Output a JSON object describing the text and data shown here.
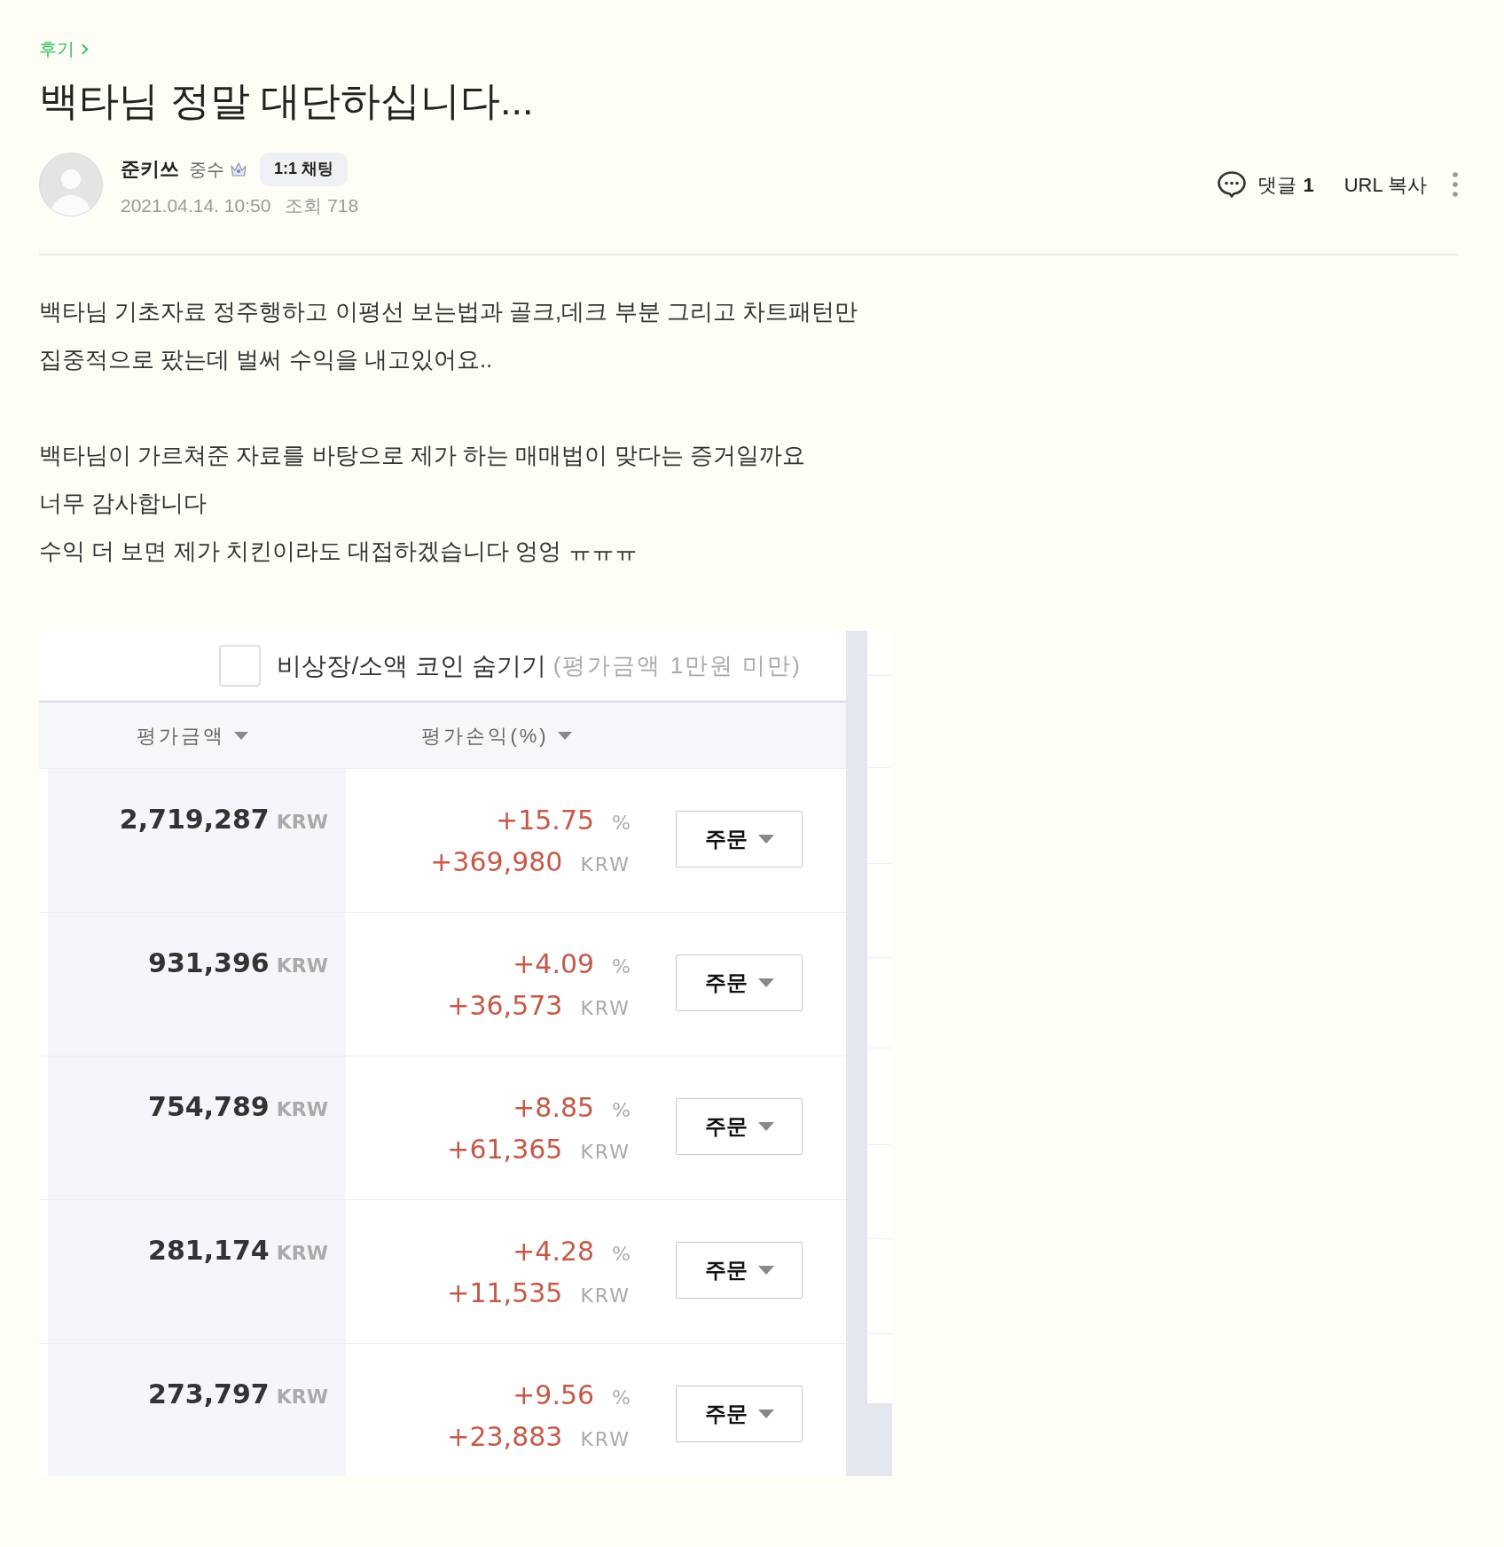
{
  "board": {
    "label": "후기"
  },
  "post": {
    "title": "백타님 정말 대단하십니다..."
  },
  "author": {
    "name": "준키쓰",
    "rank": "중수",
    "chat_button": "1:1 채팅",
    "date": "2021.04.14. 10:50",
    "views": "조회 718"
  },
  "actions": {
    "comments_label": "댓글",
    "comments_count": "1",
    "copy_url": "URL 복사"
  },
  "body": {
    "paragraphs": [
      [
        "백타님 기초자료 정주행하고 이평선 보는법과 골크,데크 부분 그리고 차트패턴만",
        "집중적으로 팠는데 벌써 수익을 내고있어요.."
      ],
      [
        "백타님이 가르쳐준 자료를 바탕으로 제가 하는 매매법이 맞다는 증거일까요",
        "너무 감사합니다",
        "수익 더 보면 제가 치킨이라도 대접하겠습니다 엉엉 ㅠㅠㅠ"
      ]
    ]
  },
  "screenshot": {
    "filter": {
      "checked": false,
      "label": "비상장/소액 코인 숨기기",
      "note": "(평가금액 1만원 미만)"
    },
    "columns": [
      {
        "label": "평가금액"
      },
      {
        "label": "평가손익(%)"
      }
    ],
    "rows": [
      {
        "amount": "2,719,287",
        "amount_unit": "KRW",
        "rate": "+15.75",
        "rate_unit": "%",
        "profit": "+369,980",
        "profit_unit": "KRW",
        "order_button": "주문"
      },
      {
        "amount": "931,396",
        "amount_unit": "KRW",
        "rate": "+4.09",
        "rate_unit": "%",
        "profit": "+36,573",
        "profit_unit": "KRW",
        "order_button": "주문"
      },
      {
        "amount": "754,789",
        "amount_unit": "KRW",
        "rate": "+8.85",
        "rate_unit": "%",
        "profit": "+61,365",
        "profit_unit": "KRW",
        "order_button": "주문"
      },
      {
        "amount": "281,174",
        "amount_unit": "KRW",
        "rate": "+4.28",
        "rate_unit": "%",
        "profit": "+11,535",
        "profit_unit": "KRW",
        "order_button": "주문"
      },
      {
        "amount": "273,797",
        "amount_unit": "KRW",
        "rate": "+9.56",
        "rate_unit": "%",
        "profit": "+23,883",
        "profit_unit": "KRW",
        "order_button": "주문"
      }
    ]
  }
}
